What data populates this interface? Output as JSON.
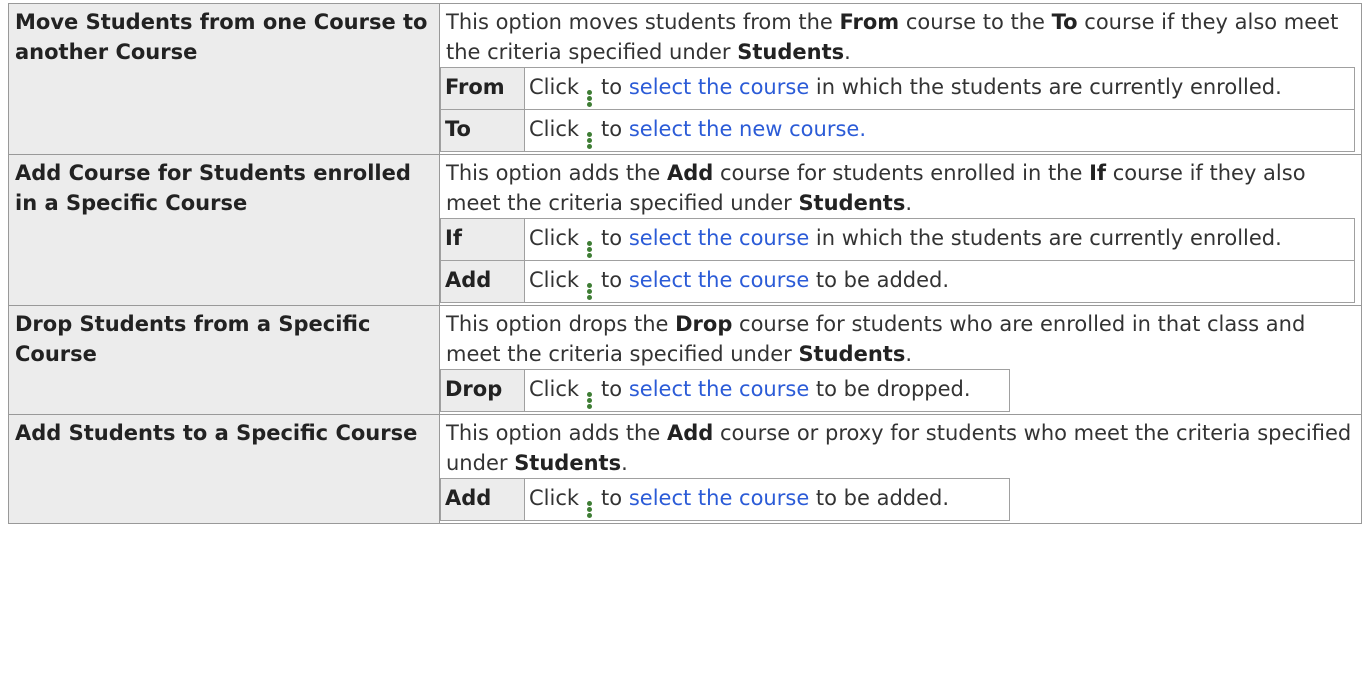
{
  "common": {
    "click": "Click",
    "to": "to",
    "icon": "vertical-ellipsis-icon",
    "criteria_students": "Students",
    "period": "."
  },
  "rows": [
    {
      "option": "Move Students from one Course to another Course",
      "desc": {
        "t1": "This option moves students from the ",
        "b1": "From",
        "t2": " course to the ",
        "b2": "To",
        "t3": " course if they also meet the criteria specified under "
      },
      "fields": [
        {
          "label": "From",
          "link": "select the course",
          "rest": " in which the students are currently enrolled."
        },
        {
          "label": "To",
          "link": "select the new course.",
          "rest": ""
        }
      ]
    },
    {
      "option": "Add Course for Students enrolled in a Specific Course",
      "desc": {
        "t1": "This option adds the ",
        "b1": "Add",
        "t2": " course for students enrolled in the ",
        "b2": "If",
        "t3": " course if they also meet the criteria specified under "
      },
      "fields": [
        {
          "label": "If",
          "link": "select the course",
          "rest": " in which the students are currently enrolled."
        },
        {
          "label": "Add",
          "link": "select the course",
          "rest": " to be added."
        }
      ]
    },
    {
      "option": "Drop Students from a Specific Course",
      "desc": {
        "t1": "This option drops the ",
        "b1": "Drop",
        "t2": " course for students who are enrolled in that class and meet the criteria specified under "
      },
      "fields": [
        {
          "label": "Drop",
          "link": "select the course",
          "rest": " to be dropped."
        }
      ]
    },
    {
      "option": "Add Students to a Specific Course",
      "desc": {
        "t1": "This option adds the ",
        "b1": "Add",
        "t2": " course or proxy for students who meet the criteria specified under "
      },
      "fields": [
        {
          "label": "Add",
          "link": "select the course",
          "rest": " to be added."
        }
      ]
    }
  ]
}
